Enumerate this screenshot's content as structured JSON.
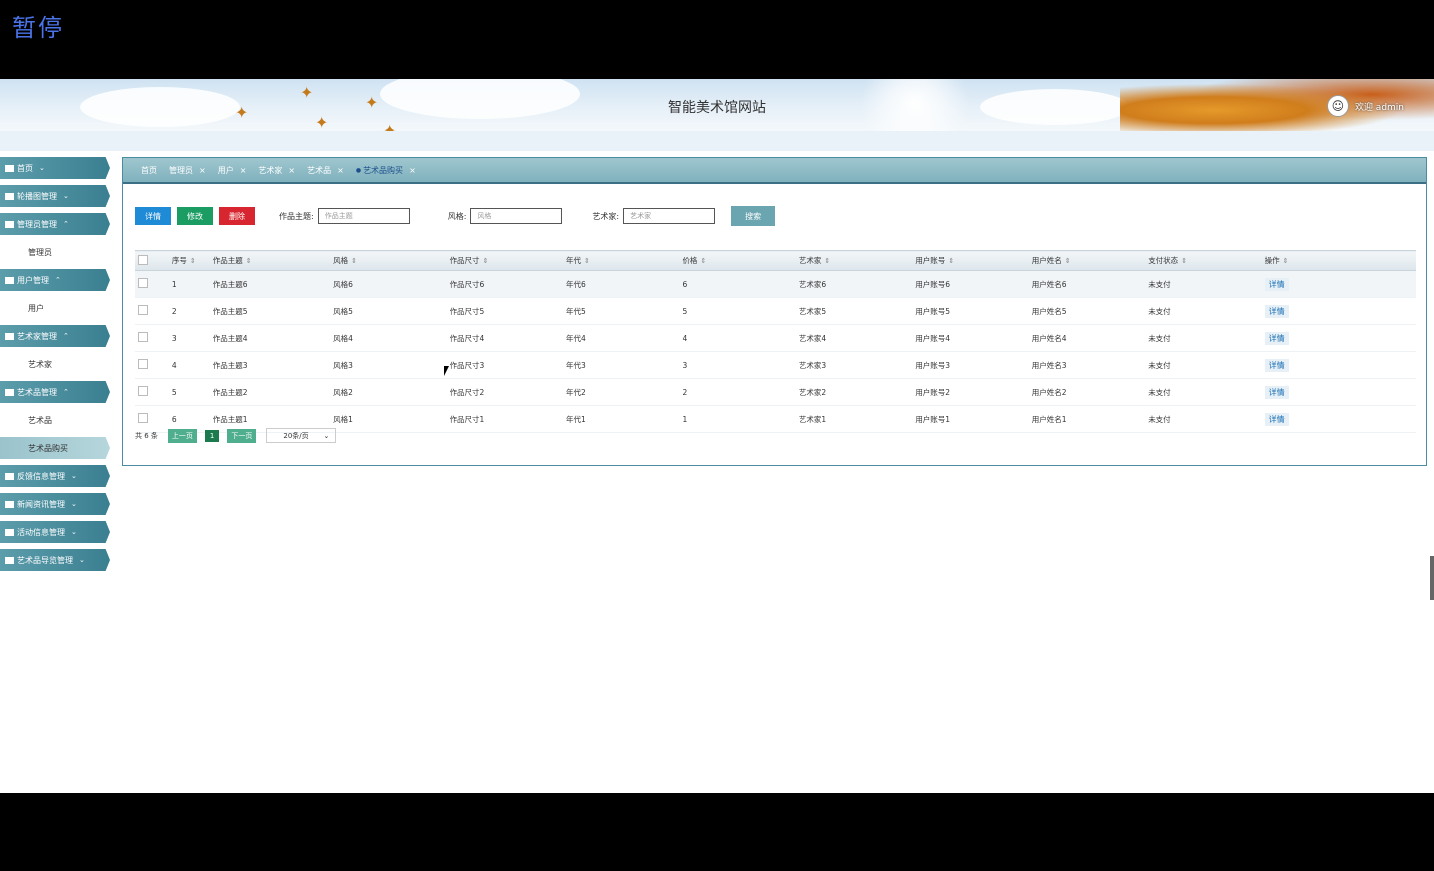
{
  "overlay": {
    "pause_label": "暂停"
  },
  "header": {
    "site_title": "智能美术馆网站",
    "welcome": "欢迎 admin",
    "avatar_glyph": "☺"
  },
  "sidebar": {
    "items": [
      {
        "label": "首页",
        "type": "head",
        "caret": "⌄"
      },
      {
        "label": "轮播图管理",
        "type": "head",
        "caret": "⌄"
      },
      {
        "label": "管理员管理",
        "type": "head",
        "caret": "⌃"
      },
      {
        "label": "管理员",
        "type": "sub"
      },
      {
        "label": "用户管理",
        "type": "head",
        "caret": "⌃"
      },
      {
        "label": "用户",
        "type": "sub"
      },
      {
        "label": "艺术家管理",
        "type": "head",
        "caret": "⌃"
      },
      {
        "label": "艺术家",
        "type": "sub"
      },
      {
        "label": "艺术品管理",
        "type": "head",
        "caret": "⌃"
      },
      {
        "label": "艺术品",
        "type": "sub"
      },
      {
        "label": "艺术品购买",
        "type": "sub",
        "active": true
      },
      {
        "label": "反馈信息管理",
        "type": "head",
        "caret": "⌄"
      },
      {
        "label": "新闻资讯管理",
        "type": "head",
        "caret": "⌄"
      },
      {
        "label": "活动信息管理",
        "type": "head",
        "caret": "⌄"
      },
      {
        "label": "艺术品导览管理",
        "type": "head",
        "caret": "⌄"
      }
    ]
  },
  "tabs": [
    {
      "label": "首页",
      "closable": false
    },
    {
      "label": "管理员",
      "closable": true
    },
    {
      "label": "用户",
      "closable": true
    },
    {
      "label": "艺术家",
      "closable": true
    },
    {
      "label": "艺术品",
      "closable": true
    },
    {
      "label": "艺术品购买",
      "closable": true,
      "active": true
    }
  ],
  "toolbar": {
    "detail": "详情",
    "edit": "修改",
    "delete": "删除",
    "search_button": "搜索",
    "filters": [
      {
        "label": "作品主题:",
        "placeholder": "作品主题"
      },
      {
        "label": "风格:",
        "placeholder": "风格"
      },
      {
        "label": "艺术家:",
        "placeholder": "艺术家"
      }
    ]
  },
  "table": {
    "columns": [
      "序号",
      "作品主题",
      "风格",
      "作品尺寸",
      "年代",
      "价格",
      "艺术家",
      "用户账号",
      "用户姓名",
      "支付状态",
      "操作"
    ],
    "rows": [
      [
        "1",
        "作品主题6",
        "风格6",
        "作品尺寸6",
        "年代6",
        "6",
        "艺术家6",
        "用户账号6",
        "用户姓名6",
        "未支付",
        "详情"
      ],
      [
        "2",
        "作品主题5",
        "风格5",
        "作品尺寸5",
        "年代5",
        "5",
        "艺术家5",
        "用户账号5",
        "用户姓名5",
        "未支付",
        "详情"
      ],
      [
        "3",
        "作品主题4",
        "风格4",
        "作品尺寸4",
        "年代4",
        "4",
        "艺术家4",
        "用户账号4",
        "用户姓名4",
        "未支付",
        "详情"
      ],
      [
        "4",
        "作品主题3",
        "风格3",
        "作品尺寸3",
        "年代3",
        "3",
        "艺术家3",
        "用户账号3",
        "用户姓名3",
        "未支付",
        "详情"
      ],
      [
        "5",
        "作品主题2",
        "风格2",
        "作品尺寸2",
        "年代2",
        "2",
        "艺术家2",
        "用户账号2",
        "用户姓名2",
        "未支付",
        "详情"
      ],
      [
        "6",
        "作品主题1",
        "风格1",
        "作品尺寸1",
        "年代1",
        "1",
        "艺术家1",
        "用户账号1",
        "用户姓名1",
        "未支付",
        "详情"
      ]
    ]
  },
  "pager": {
    "total": "共 6 条",
    "prev": "上一页",
    "current": "1",
    "next": "下一页",
    "page_size": "20条/页"
  },
  "colors": {
    "accent": "#3a7f91",
    "detail": "#1f8ad6",
    "edit": "#1a9c62",
    "delete": "#d7262f"
  }
}
